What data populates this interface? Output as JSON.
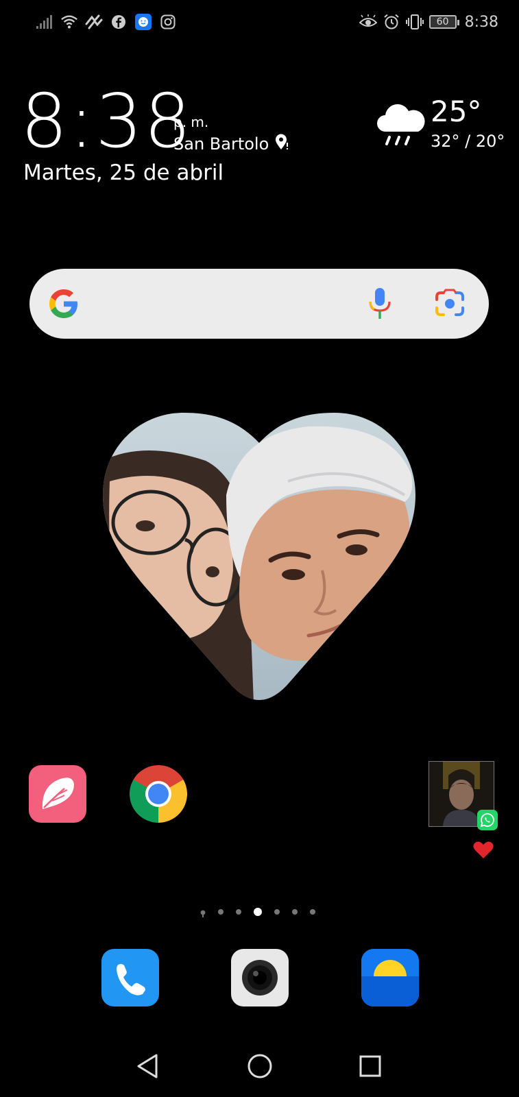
{
  "status_bar": {
    "left_icons": [
      "signal-icon",
      "wifi-icon",
      "data-saver-icon",
      "facebook-icon",
      "messenger-kids-icon",
      "instagram-icon"
    ],
    "right_icons": [
      "eye-comfort-icon",
      "alarm-icon",
      "vibrate-icon"
    ],
    "battery_level": "60",
    "time": "8:38"
  },
  "clock_widget": {
    "time": "8:38",
    "ampm": "p. m.",
    "city": "San Bartolo",
    "date": "Martes, 25 de abril"
  },
  "weather_widget": {
    "icon": "rain-cloud-icon",
    "temperature": "25°",
    "range": "32° / 20°"
  },
  "search_bar": {
    "logo": "google-g-icon",
    "mic": "google-mic-icon",
    "lens": "google-lens-icon"
  },
  "photo_widget": {
    "shape": "heart"
  },
  "home_apps": [
    {
      "name": "flo-app-icon"
    },
    {
      "name": "chrome-app-icon"
    }
  ],
  "contact_shortcut": {
    "badge": "whatsapp-icon",
    "label_icon": "red-heart-emoji"
  },
  "page_indicator": {
    "pages": 7,
    "active_index": 3
  },
  "dock": [
    {
      "name": "phone-app-icon"
    },
    {
      "name": "camera-app-icon"
    },
    {
      "name": "weather-app-icon"
    }
  ],
  "nav_bar": {
    "buttons": [
      "back",
      "home",
      "recents"
    ]
  },
  "colors": {
    "background": "#000000",
    "search_bar": "#ececec",
    "flo": "#f2607d",
    "phone": "#2196f3",
    "weather_app": "#1479f0",
    "whatsapp": "#25d366"
  }
}
